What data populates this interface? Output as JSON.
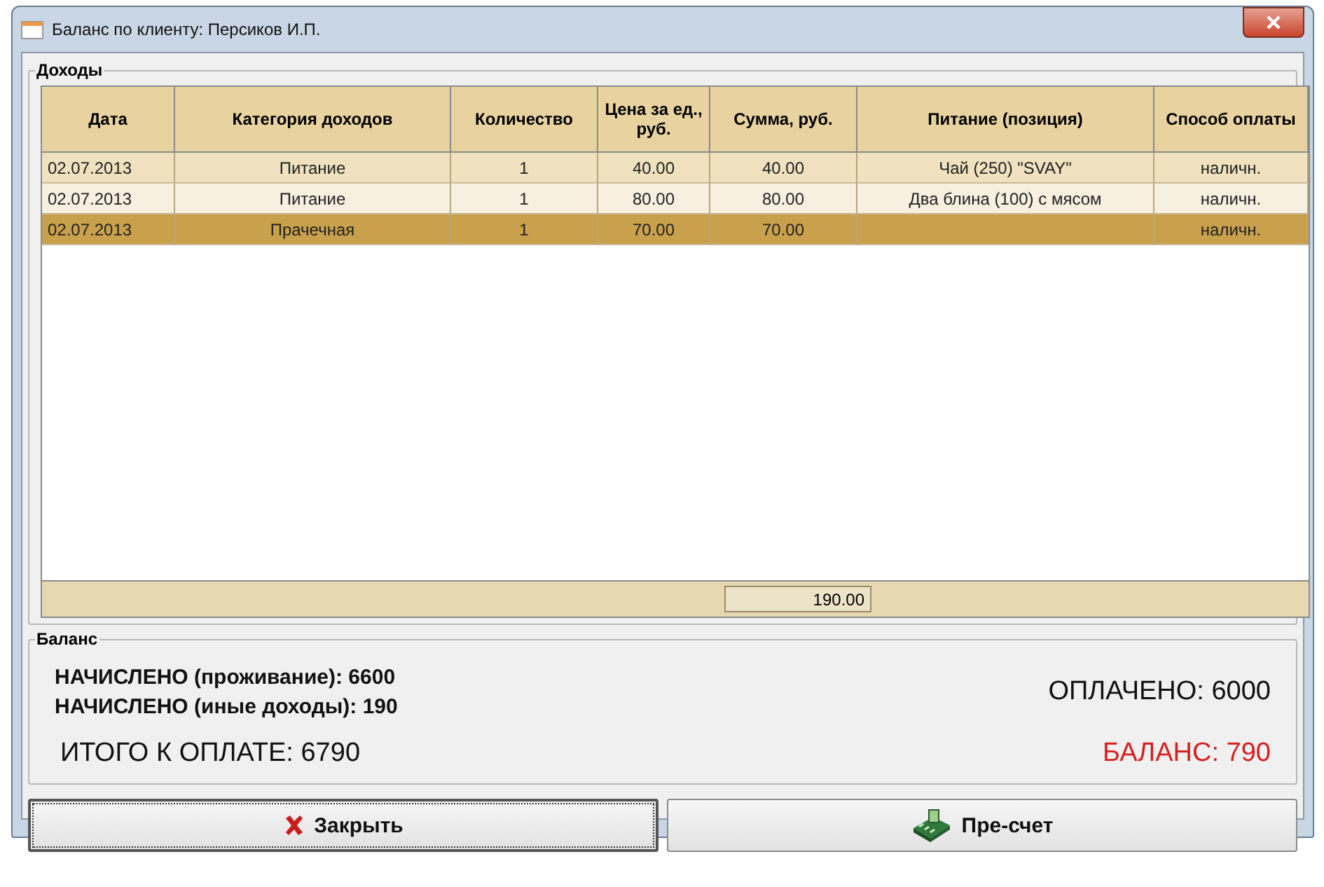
{
  "window": {
    "title": "Баланс по клиенту: Персиков И.П."
  },
  "income": {
    "title": "Доходы",
    "table": {
      "columns": [
        "Дата",
        "Категория доходов",
        "Количество",
        "Цена за ед., руб.",
        "Сумма, руб.",
        "Питание (позиция)",
        "Способ оплаты"
      ],
      "rows": [
        {
          "cells": [
            "02.07.2013",
            "Питание",
            "1",
            "40.00",
            "40.00",
            "Чай (250)  \"SVAY\"",
            "наличн."
          ],
          "selected": false
        },
        {
          "cells": [
            "02.07.2013",
            "Питание",
            "1",
            "80.00",
            "80.00",
            "Два блина (100) с мясом",
            "наличн."
          ],
          "selected": false
        },
        {
          "cells": [
            "02.07.2013",
            "Прачечная",
            "1",
            "70.00",
            "70.00",
            "",
            "наличн."
          ],
          "selected": true
        }
      ],
      "total": "190.00"
    }
  },
  "balance": {
    "title": "Баланс",
    "accrued_living": "НАЧИСЛЕНО (проживание): 6600",
    "accrued_other": "НАЧИСЛЕНО (иные доходы): 190",
    "total_due": "ИТОГО К ОПЛАТЕ: 6790",
    "paid": "ОПЛАЧЕНО: 6000",
    "balance": "БАЛАНС: 790"
  },
  "buttons": [
    {
      "label": "Закрыть",
      "kind": "close"
    },
    {
      "label": "Пре-счет",
      "kind": "recalc"
    }
  ]
}
